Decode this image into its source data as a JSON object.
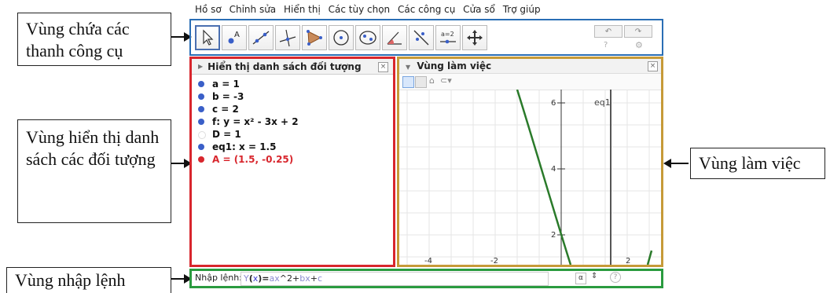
{
  "menu": [
    "Hồ sơ",
    "Chỉnh sửa",
    "Hiển thị",
    "Các tùy chọn",
    "Các công cụ",
    "Cửa sổ",
    "Trợ giúp"
  ],
  "callouts": {
    "toolbar": "Vùng chứa các thanh công cụ",
    "algebra": "Vùng hiển thị danh sách các đối tượng",
    "workspace": "Vùng làm việc",
    "input": "Vùng nhập lệnh"
  },
  "toolbar": {
    "tools": [
      "move-tool-icon",
      "point-tool-icon",
      "line-tool-icon",
      "perpendicular-tool-icon",
      "polygon-tool-icon",
      "circle-tool-icon",
      "conic-tool-icon",
      "angle-tool-icon",
      "reflect-tool-icon",
      "slider-tool-icon",
      "move-view-tool-icon"
    ],
    "slider_text": "a=2",
    "undo": "↶",
    "redo": "↷",
    "help": "?",
    "settings": "⚙"
  },
  "algebra": {
    "title": "Hiển thị danh sách đối tượng",
    "objects": [
      {
        "text": "a = 1",
        "color": "#111111",
        "hollow": false
      },
      {
        "text": "b = -3",
        "color": "#111111",
        "hollow": false
      },
      {
        "text": "c = 2",
        "color": "#111111",
        "hollow": false
      },
      {
        "text": "f: y = x² - 3x + 2",
        "color": "#111111",
        "hollow": false
      },
      {
        "text": "D = 1",
        "color": "#111111",
        "hollow": true
      },
      {
        "text": "eq1: x = 1.5",
        "color": "#111111",
        "hollow": false
      },
      {
        "text": "A = (1.5, -0.25)",
        "color": "#d8262d",
        "hollow": false
      }
    ]
  },
  "graphics": {
    "title": "Vùng làm việc",
    "axis_labels": {
      "y6": "6",
      "y4": "4",
      "y2": "2",
      "xm4": "-4",
      "xm2": "-2",
      "x2": "2"
    },
    "line_label": "eq1"
  },
  "input": {
    "label": "Nhập lệnh:",
    "expr": [
      {
        "t": "Y",
        "c": "#8a8ad0"
      },
      {
        "t": "(",
        "c": "#222222"
      },
      {
        "t": "x",
        "c": "#3a3ad0"
      },
      {
        "t": ")=",
        "c": "#222222"
      },
      {
        "t": "ax",
        "c": "#8a8ad0"
      },
      {
        "t": "^2+",
        "c": "#222222"
      },
      {
        "t": "bx",
        "c": "#8a8ad0"
      },
      {
        "t": "+",
        "c": "#222222"
      },
      {
        "t": "c",
        "c": "#8a8ad0"
      }
    ],
    "alpha": "α",
    "help": "?"
  }
}
